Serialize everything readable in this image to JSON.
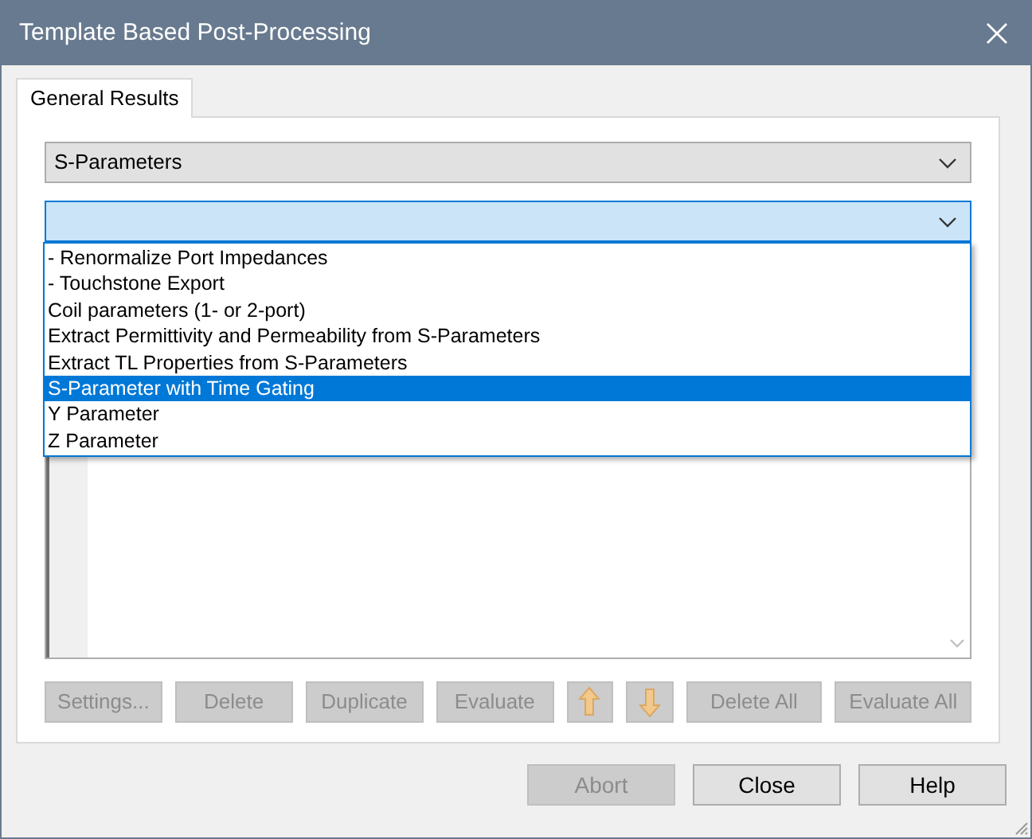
{
  "window": {
    "title": "Template Based Post-Processing"
  },
  "tabs": [
    {
      "label": "General Results",
      "selected": true
    }
  ],
  "category_combo": {
    "value": "S-Parameters"
  },
  "template_combo": {
    "expanded": true
  },
  "template_options": [
    {
      "label": "- Renormalize Port Impedances",
      "selected": false
    },
    {
      "label": "- Touchstone Export",
      "selected": false
    },
    {
      "label": "Coil parameters (1- or 2-port)",
      "selected": false
    },
    {
      "label": "Extract Permittivity and Permeability from S-Parameters",
      "selected": false
    },
    {
      "label": "Extract TL Properties from S-Parameters",
      "selected": false
    },
    {
      "label": "S-Parameter with Time Gating",
      "selected": true
    },
    {
      "label": "Y Parameter",
      "selected": false
    },
    {
      "label": "Z Parameter",
      "selected": false
    }
  ],
  "list_buttons": [
    {
      "kind": "text",
      "label": "Settings...",
      "disabled": true
    },
    {
      "kind": "text",
      "label": "Delete",
      "disabled": true
    },
    {
      "kind": "text",
      "label": "Duplicate",
      "disabled": true
    },
    {
      "kind": "text",
      "label": "Evaluate",
      "disabled": true
    },
    {
      "kind": "up",
      "disabled": true
    },
    {
      "kind": "down",
      "disabled": true
    },
    {
      "kind": "text",
      "label": "Delete All",
      "disabled": true
    },
    {
      "kind": "text",
      "label": "Evaluate All",
      "disabled": true
    }
  ],
  "dialog_buttons": [
    {
      "label": "Abort",
      "disabled": true
    },
    {
      "label": "Close",
      "disabled": false
    },
    {
      "label": "Help",
      "disabled": false
    }
  ]
}
